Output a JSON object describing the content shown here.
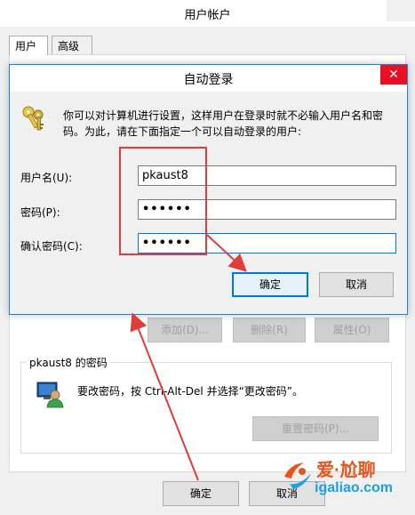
{
  "outer_window": {
    "title": "用户帐户",
    "tabs": [
      {
        "label": "用户"
      },
      {
        "label": "高级"
      }
    ],
    "buttons": {
      "add": "添加(D)...",
      "remove": "删除(R)",
      "properties": "属性(O)"
    },
    "password_group": {
      "title": "pkaust8 的密码",
      "text": "要改密码，按 Ctrl-Alt-Del 并选择“更改密码”。",
      "reset_button": "重置密码(P)..."
    },
    "ok_label": "确定",
    "cancel_label": "取消"
  },
  "dialog": {
    "title": "自动登录",
    "close_symbol": "✕",
    "description": "你可以对计算机进行设置，这样用户在登录时就不必输入用户名和密码。为此，请在下面指定一个可以自动登录的用户:",
    "fields": {
      "username_label": "用户名(U):",
      "username_value": "pkaust8",
      "password_label": "密码(P):",
      "password_value": "••••••",
      "confirm_label": "确认密码(C):",
      "confirm_value": "••••••"
    },
    "ok_label": "确定",
    "cancel_label": "取消"
  },
  "watermark": {
    "brand": "爱·尬聊",
    "url": "igaliao.com"
  },
  "colors": {
    "annotation_red": "#e23b3b",
    "accent_blue": "#0078d7",
    "close_red": "#e81123"
  }
}
